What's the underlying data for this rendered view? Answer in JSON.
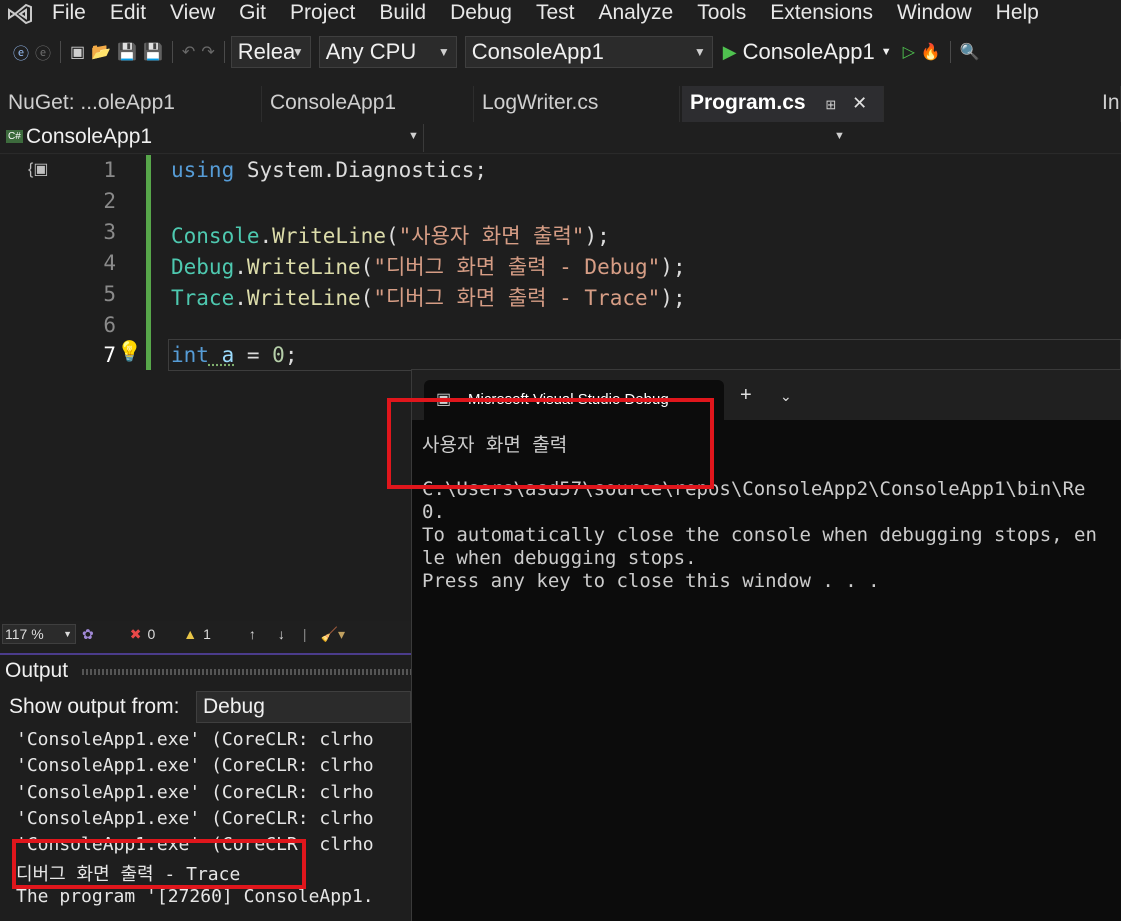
{
  "menu": [
    "File",
    "Edit",
    "View",
    "Git",
    "Project",
    "Build",
    "Debug",
    "Test",
    "Analyze",
    "Tools",
    "Extensions",
    "Window",
    "Help"
  ],
  "toolbar": {
    "config": "Relea",
    "platform": "Any CPU",
    "project": "ConsoleApp1",
    "run_label": "ConsoleApp1"
  },
  "tabs": [
    {
      "label": "NuGet: ...oleApp1"
    },
    {
      "label": "ConsoleApp1"
    },
    {
      "label": "LogWriter.cs"
    },
    {
      "label": "Program.cs",
      "active": true
    },
    {
      "label": "In"
    }
  ],
  "navbar": {
    "scope": "ConsoleApp1"
  },
  "editor": {
    "line_numbers": [
      "1",
      "2",
      "3",
      "4",
      "5",
      "6",
      "7"
    ],
    "lines": {
      "l1_kw": "using",
      "l1_rest": " System.Diagnostics;",
      "l3_cls": "Console",
      "l3_dot": ".",
      "l3_mth": "WriteLine",
      "l3_open": "(",
      "l3_str": "\"사용자 화면 출력\"",
      "l3_close": ");",
      "l4_cls": "Debug",
      "l4_dot": ".",
      "l4_mth": "WriteLine",
      "l4_open": "(",
      "l4_str": "\"디버그 화면 출력 - Debug\"",
      "l4_close": ");",
      "l5_cls": "Trace",
      "l5_dot": ".",
      "l5_mth": "WriteLine",
      "l5_open": "(",
      "l5_str": "\"디버그 화면 출력 - Trace\"",
      "l5_close": ");",
      "l7_kw": "int",
      "l7_var": " a",
      "l7_eq": " = ",
      "l7_num": "0",
      "l7_semi": ";"
    }
  },
  "status": {
    "zoom": "117 %",
    "errors": "0",
    "warnings": "1"
  },
  "output": {
    "title": "Output",
    "show_from_label": "Show output from:",
    "source": "Debug",
    "lines": [
      "'ConsoleApp1.exe' (CoreCLR: clrho",
      "'ConsoleApp1.exe' (CoreCLR: clrho",
      "'ConsoleApp1.exe' (CoreCLR: clrho",
      "'ConsoleApp1.exe' (CoreCLR: clrho",
      "'ConsoleApp1.exe' (CoreCLR: clrho",
      "디버그 화면 출력 - Trace",
      "The program '[27260] ConsoleApp1."
    ]
  },
  "console": {
    "title": "Microsoft Visual Studio Debug",
    "lines": [
      "사용자 화면 출력",
      "",
      "C:\\Users\\asd57\\source\\repos\\ConsoleApp2\\ConsoleApp1\\bin\\Re",
      "0.",
      "To automatically close the console when debugging stops, en",
      "le when debugging stops.",
      "Press any key to close this window . . ."
    ]
  },
  "colors": {
    "highlight_box": "#e0161c",
    "accent": "#4b3c8c"
  }
}
